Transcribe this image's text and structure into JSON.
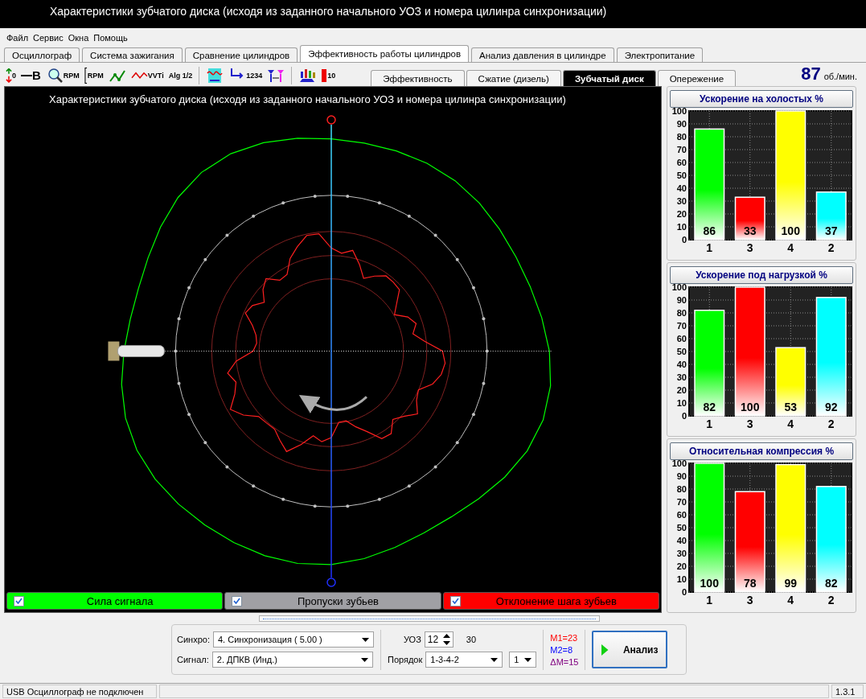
{
  "window": {
    "title": "Характеристики зубчатого диска (исходя из заданного начального УОЗ и номера цилинра синхронизации)"
  },
  "menu": [
    "Файл",
    "Сервис",
    "Окна",
    "Помощь"
  ],
  "tabs": [
    {
      "label": "Осциллограф",
      "selected": false
    },
    {
      "label": "Система зажигания",
      "selected": false
    },
    {
      "label": "Сравнение цилиндров",
      "selected": false
    },
    {
      "label": "Эффективность работы цилиндров",
      "selected": true
    },
    {
      "label": "Анализ давления в цилиндре",
      "selected": false
    },
    {
      "label": "Электропитание",
      "selected": false
    }
  ],
  "toolbar": [
    {
      "kind": "zero-arrows",
      "label": "0"
    },
    {
      "kind": "bold",
      "label": "B"
    },
    {
      "kind": "rpm-magnifier",
      "label": "RPM"
    },
    {
      "kind": "rpm-scale",
      "label": "RPM"
    },
    {
      "kind": "zigzag"
    },
    {
      "kind": "vvti",
      "label": "VVTi"
    },
    {
      "kind": "algorithm",
      "label": "Alg 1/2"
    },
    {
      "kind": "separator"
    },
    {
      "kind": "waveform"
    },
    {
      "kind": "arrow-numbers",
      "label": "1234"
    },
    {
      "kind": "filters"
    },
    {
      "kind": "separator"
    },
    {
      "kind": "bars-car"
    },
    {
      "kind": "red-bar",
      "label": "10"
    }
  ],
  "subtabs": [
    {
      "label": "Эффективность",
      "selected": false
    },
    {
      "label": "Сжатие (дизель)",
      "selected": false
    },
    {
      "label": "Зубчатый диск",
      "selected": true
    },
    {
      "label": "Опережение",
      "selected": false
    }
  ],
  "rpm": {
    "value": "87",
    "unit": "об./мин."
  },
  "canvas": {
    "title": "Характеристики зубчатого диска (исходя из заданного начального УОЗ и номера цилинра синхронизации)"
  },
  "legend": [
    {
      "label": "Сила сигнала",
      "checked": true,
      "color": "#00ff00"
    },
    {
      "label": "Пропуски зубьев",
      "checked": true,
      "color": "#a0a0a4"
    },
    {
      "label": "Отклонение шага зубьев",
      "checked": true,
      "color": "#ff0000"
    }
  ],
  "charts": [
    {
      "bars": [
        {
          "color": "#00ff00"
        },
        {
          "color": "#ff0000"
        },
        {
          "color": "#ffff00"
        },
        {
          "color": "#00ffff"
        }
      ],
      "chart_data": {
        "type": "bar",
        "title": "Ускорение на холостых %",
        "categories": [
          "1",
          "3",
          "4",
          "2"
        ],
        "series": [
          {
            "values": [
              86,
              33,
              100,
              37
            ]
          }
        ],
        "ylim": [
          0,
          100
        ],
        "yticks": [
          0,
          10,
          20,
          30,
          40,
          50,
          60,
          70,
          80,
          90,
          100
        ],
        "grid": true,
        "data_labels": true
      }
    },
    {
      "bars": [
        {
          "color": "#00ff00"
        },
        {
          "color": "#ff0000"
        },
        {
          "color": "#ffff00"
        },
        {
          "color": "#00ffff"
        }
      ],
      "chart_data": {
        "type": "bar",
        "title": "Ускорение под нагрузкой %",
        "categories": [
          "1",
          "3",
          "4",
          "2"
        ],
        "series": [
          {
            "values": [
              82,
              100,
              53,
              92
            ]
          }
        ],
        "ylim": [
          0,
          100
        ],
        "yticks": [
          0,
          10,
          20,
          30,
          40,
          50,
          60,
          70,
          80,
          90,
          100
        ],
        "grid": true,
        "data_labels": true
      }
    },
    {
      "bars": [
        {
          "color": "#00ff00"
        },
        {
          "color": "#ff0000"
        },
        {
          "color": "#ffff00"
        },
        {
          "color": "#00ffff"
        }
      ],
      "chart_data": {
        "type": "bar",
        "title": "Относительная компрессия %",
        "categories": [
          "1",
          "3",
          "4",
          "2"
        ],
        "series": [
          {
            "values": [
              100,
              78,
              99,
              82
            ]
          }
        ],
        "ylim": [
          0,
          100
        ],
        "yticks": [
          0,
          10,
          20,
          30,
          40,
          50,
          60,
          70,
          80,
          90,
          100
        ],
        "grid": true,
        "data_labels": true
      }
    }
  ],
  "controls": {
    "sync": {
      "label": "Синхро:",
      "value": "4.  Синхронизация ( 5.00 )"
    },
    "signal": {
      "label": "Сигнал:",
      "value": "2.  ДПКВ (Инд.)"
    },
    "uoz": {
      "label": "УОЗ",
      "value": "12",
      "extra": "30"
    },
    "order": {
      "label": "Порядок",
      "value": "1-3-4-2",
      "cylinder": "1"
    },
    "marks": [
      {
        "text": "M1=23",
        "color": "#ff0000"
      },
      {
        "text": "M2=8",
        "color": "#0000ff"
      },
      {
        "text": "ΔM=15",
        "color": "#800080"
      }
    ],
    "analyze_button": "Анализ"
  },
  "status_bar": {
    "message": "USB Осциллограф не подключен",
    "version": "1.3.1"
  }
}
